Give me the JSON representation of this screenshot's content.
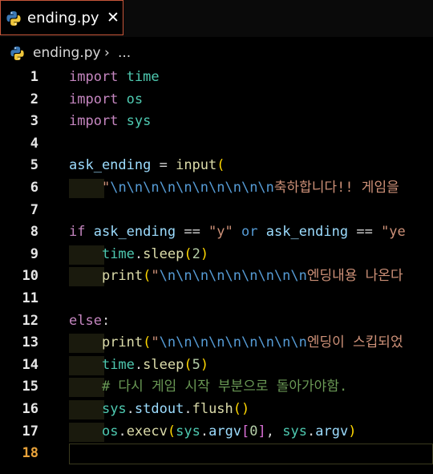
{
  "tab": {
    "filename": "ending.py",
    "close_glyph": "✕"
  },
  "breadcrumb": {
    "file": "ending.py",
    "chevron": "›",
    "more": "..."
  },
  "lines": [
    {
      "n": "1",
      "tokens": [
        [
          "kw",
          "import"
        ],
        [
          "op",
          " "
        ],
        [
          "mod",
          "time"
        ]
      ]
    },
    {
      "n": "2",
      "tokens": [
        [
          "kw",
          "import"
        ],
        [
          "op",
          " "
        ],
        [
          "mod",
          "os"
        ]
      ]
    },
    {
      "n": "3",
      "tokens": [
        [
          "kw",
          "import"
        ],
        [
          "op",
          " "
        ],
        [
          "mod",
          "sys"
        ]
      ]
    },
    {
      "n": "4",
      "tokens": []
    },
    {
      "n": "5",
      "tokens": [
        [
          "var",
          "ask_ending"
        ],
        [
          "op",
          " = "
        ],
        [
          "fn",
          "input"
        ],
        [
          "bracket",
          "("
        ]
      ]
    },
    {
      "n": "6",
      "indent": true,
      "tokens": [
        [
          "op",
          "    "
        ],
        [
          "str",
          "\""
        ],
        [
          "blue",
          "\\n\\n\\n\\n\\n\\n\\n\\n\\n\\n"
        ],
        [
          "str",
          "축하합니다!! 게임을"
        ]
      ]
    },
    {
      "n": "7",
      "tokens": []
    },
    {
      "n": "8",
      "tokens": [
        [
          "kw",
          "if"
        ],
        [
          "op",
          " "
        ],
        [
          "var",
          "ask_ending"
        ],
        [
          "op",
          " == "
        ],
        [
          "str",
          "\"y\""
        ],
        [
          "op",
          " "
        ],
        [
          "blue",
          "or"
        ],
        [
          "op",
          " "
        ],
        [
          "var",
          "ask_ending"
        ],
        [
          "op",
          " == "
        ],
        [
          "str",
          "\"ye"
        ]
      ]
    },
    {
      "n": "9",
      "indent": true,
      "tokens": [
        [
          "op",
          "    "
        ],
        [
          "mod",
          "time"
        ],
        [
          "op",
          "."
        ],
        [
          "fn",
          "sleep"
        ],
        [
          "bracket",
          "("
        ],
        [
          "num",
          "2"
        ],
        [
          "bracket",
          ")"
        ]
      ]
    },
    {
      "n": "10",
      "indent": true,
      "tokens": [
        [
          "op",
          "    "
        ],
        [
          "fn",
          "print"
        ],
        [
          "bracket",
          "("
        ],
        [
          "str",
          "\""
        ],
        [
          "blue",
          "\\n\\n\\n\\n\\n\\n\\n\\n\\n"
        ],
        [
          "str",
          "엔딩내용 나온다"
        ]
      ]
    },
    {
      "n": "11",
      "tokens": []
    },
    {
      "n": "12",
      "tokens": [
        [
          "kw",
          "else"
        ],
        [
          "op",
          ":"
        ]
      ]
    },
    {
      "n": "13",
      "indent": true,
      "tokens": [
        [
          "op",
          "    "
        ],
        [
          "fn",
          "print"
        ],
        [
          "bracket",
          "("
        ],
        [
          "str",
          "\""
        ],
        [
          "blue",
          "\\n\\n\\n\\n\\n\\n\\n\\n\\n"
        ],
        [
          "str",
          "엔딩이 스킵되었"
        ]
      ]
    },
    {
      "n": "14",
      "indent": true,
      "tokens": [
        [
          "op",
          "    "
        ],
        [
          "mod",
          "time"
        ],
        [
          "op",
          "."
        ],
        [
          "fn",
          "sleep"
        ],
        [
          "bracket",
          "("
        ],
        [
          "num",
          "5"
        ],
        [
          "bracket",
          ")"
        ]
      ]
    },
    {
      "n": "15",
      "indent": true,
      "tokens": [
        [
          "op",
          "    "
        ],
        [
          "cm",
          "# 다시 게임 시작 부분으로 돌아가야함."
        ]
      ]
    },
    {
      "n": "16",
      "indent": true,
      "tokens": [
        [
          "op",
          "    "
        ],
        [
          "mod",
          "sys"
        ],
        [
          "op",
          "."
        ],
        [
          "var",
          "stdout"
        ],
        [
          "op",
          "."
        ],
        [
          "fn",
          "flush"
        ],
        [
          "bracket",
          "()"
        ]
      ]
    },
    {
      "n": "17",
      "indent": true,
      "tokens": [
        [
          "op",
          "    "
        ],
        [
          "mod",
          "os"
        ],
        [
          "op",
          "."
        ],
        [
          "fn",
          "execv"
        ],
        [
          "bracket",
          "("
        ],
        [
          "mod",
          "sys"
        ],
        [
          "op",
          "."
        ],
        [
          "var",
          "argv"
        ],
        [
          "bracket2",
          "["
        ],
        [
          "num",
          "0"
        ],
        [
          "bracket2",
          "]"
        ],
        [
          "op",
          ", "
        ],
        [
          "mod",
          "sys"
        ],
        [
          "op",
          "."
        ],
        [
          "var",
          "argv"
        ],
        [
          "bracket",
          ")"
        ]
      ]
    },
    {
      "n": "18",
      "active": true,
      "tokens": []
    }
  ]
}
